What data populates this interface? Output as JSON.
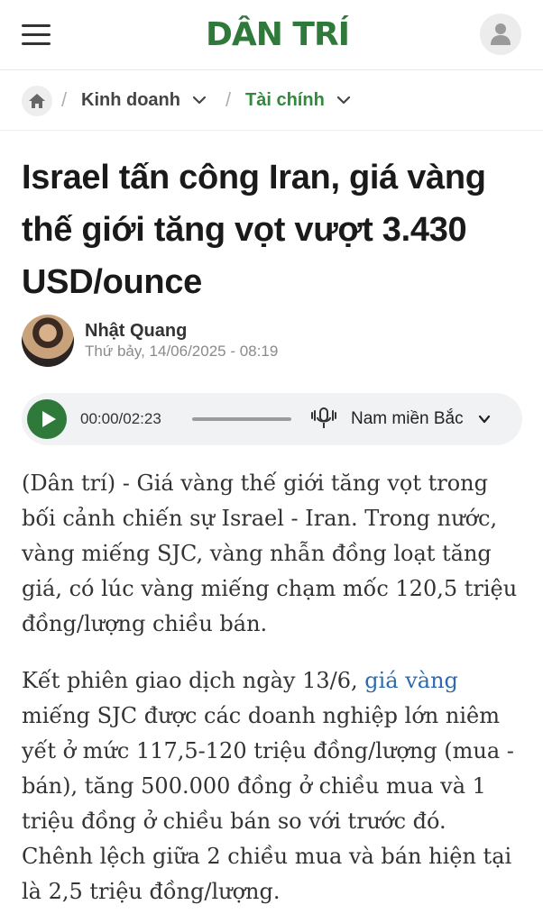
{
  "header": {
    "logo_text": "DÂN TRÍ",
    "brand_color": "#2f7a3b"
  },
  "breadcrumb": {
    "items": [
      {
        "label": "Kinh doanh"
      },
      {
        "label": "Tài chính"
      }
    ]
  },
  "article": {
    "title": "Israel tấn công Iran, giá vàng thế giới tăng vọt vượt 3.430 USD/ounce",
    "author_name": "Nhật Quang",
    "date": "Thứ bảy, 14/06/2025 - 08:19",
    "paragraph_1": "(Dân trí) - Giá vàng thế giới tăng vọt trong bối cảnh chiến sự Israel - Iran. Trong nước, vàng miếng SJC, vàng nhẫn đồng loạt tăng giá, có lúc vàng miếng chạm mốc 120,5 triệu đồng/lượng chiều bán.",
    "paragraph_2_before": "Kết phiên giao dịch ngày 13/6, ",
    "paragraph_2_link": "giá vàng",
    "paragraph_2_after": " miếng SJC được các doanh nghiệp lớn niêm yết ở mức 117,5-120 triệu đồng/lượng (mua - bán), tăng 500.000 đồng ở chiều mua và 1 triệu đồng ở chiều bán so với trước đó. Chênh lệch giữa 2 chiều mua và bán hiện tại là 2,5 triệu đồng/lượng."
  },
  "audio": {
    "time": "00:00/02:23",
    "progress": 0,
    "voice": "Nam miền Bắc"
  },
  "icons": {
    "menu": "hamburger-icon",
    "user": "user-icon",
    "home": "home-icon",
    "play": "play-icon",
    "mic": "microphone-icon"
  }
}
